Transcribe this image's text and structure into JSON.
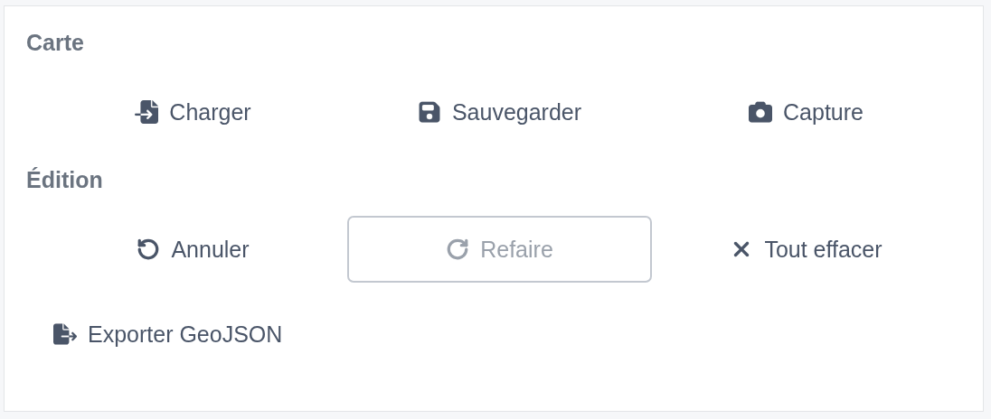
{
  "sections": [
    {
      "title": "Carte",
      "buttons": [
        {
          "label": "Charger",
          "disabled": false,
          "focused": false
        },
        {
          "label": "Sauvegarder",
          "disabled": false,
          "focused": false
        },
        {
          "label": "Capture",
          "disabled": false,
          "focused": false
        }
      ]
    },
    {
      "title": "Édition",
      "buttons": [
        {
          "label": "Annuler",
          "disabled": false,
          "focused": false
        },
        {
          "label": "Refaire",
          "disabled": true,
          "focused": true
        },
        {
          "label": "Tout effacer",
          "disabled": false,
          "focused": false
        },
        {
          "label": "Exporter GeoJSON",
          "disabled": false,
          "focused": false
        }
      ]
    }
  ]
}
